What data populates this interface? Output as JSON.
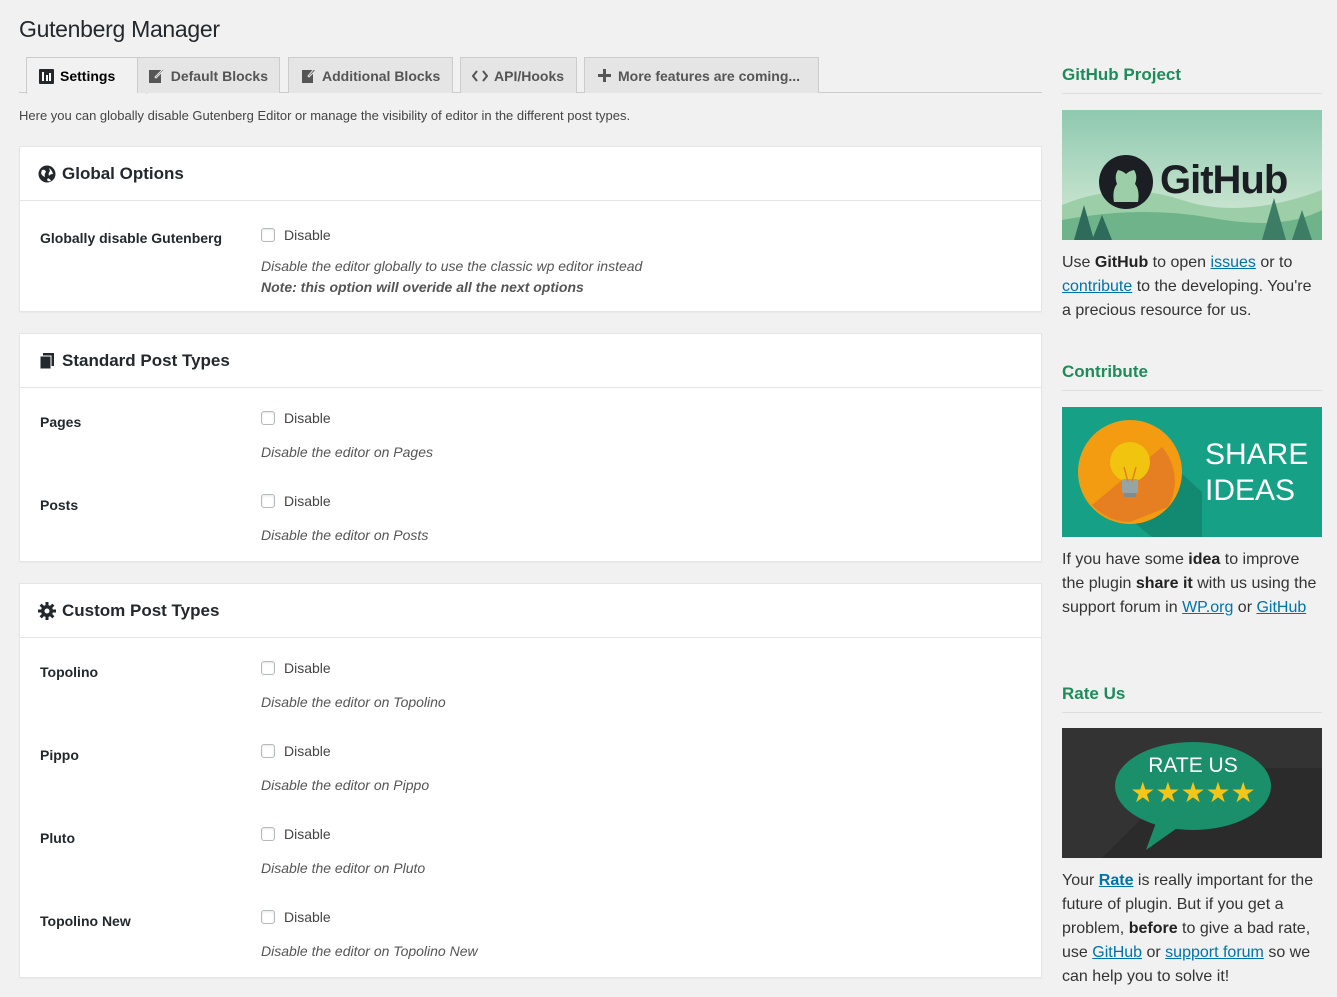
{
  "page": {
    "title": "Gutenberg Manager"
  },
  "tabs": [
    {
      "label": "Settings",
      "icon": "settings-tab-icon",
      "active": true
    },
    {
      "label": "Default Blocks",
      "icon": "edit-icon"
    },
    {
      "label": "Additional Blocks",
      "icon": "edit-page-icon"
    },
    {
      "label": "API/Hooks",
      "icon": "code-icon"
    },
    {
      "label": "More features are coming...",
      "icon": "plus-icon"
    }
  ],
  "intro": "Here you can globally disable Gutenberg Editor or manage the visibility of editor in the different post types.",
  "checkbox_label": "Disable",
  "global": {
    "title": "Global Options",
    "label": "Globally disable Gutenberg",
    "desc1": "Disable the editor globally to use the classic wp editor instead",
    "desc2": "Note: this option will overide all the next options"
  },
  "standard": {
    "title": "Standard Post Types",
    "rows": [
      {
        "label": "Pages",
        "desc": "Disable the editor on Pages"
      },
      {
        "label": "Posts",
        "desc": "Disable the editor on Posts"
      }
    ]
  },
  "custom": {
    "title": "Custom Post Types",
    "rows": [
      {
        "label": "Topolino",
        "desc": "Disable the editor on Topolino"
      },
      {
        "label": "Pippo",
        "desc": "Disable the editor on Pippo"
      },
      {
        "label": "Pluto",
        "desc": "Disable the editor on Pluto"
      },
      {
        "label": "Topolino New",
        "desc": "Disable the editor on Topolino New"
      }
    ]
  },
  "sidebar": {
    "github": {
      "title": "GitHub Project",
      "banner_text": "GitHub",
      "t1": "Use ",
      "b1": "GitHub",
      "t2": " to open ",
      "link1": "issues",
      "t3": " or to ",
      "link2": "contribute",
      "t4": " to the developing. You're a precious resource for us."
    },
    "contribute": {
      "title": "Contribute",
      "banner_line1": "SHARE",
      "banner_line2": "IDEAS",
      "t1": "If you have some ",
      "b1": "idea",
      "t2": " to improve the plugin ",
      "b2": "share it",
      "t3": " with us using the support forum in ",
      "link1": "WP.org",
      "t4": " or ",
      "link2": "GitHub"
    },
    "rate": {
      "title": "Rate Us",
      "banner_text": "RATE US",
      "stars": 5,
      "t1": "Your ",
      "link1": "Rate",
      "t2": " is really important for the future of plugin. But if you get a problem, ",
      "b1": "before",
      "t3": " to give a bad rate, use ",
      "link2": "GitHub",
      "t4": " or ",
      "link3": "support forum",
      "t5": " so we can help you to solve it!"
    }
  },
  "colors": {
    "accent_green": "#1e8c5a",
    "link": "#0073aa",
    "share_bg": "#16a085",
    "rate_bg": "#333333",
    "bubble": "#1a8f6a",
    "star": "#f5c518"
  }
}
